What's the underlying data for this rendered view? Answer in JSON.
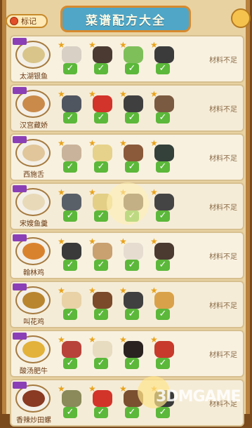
{
  "header": {
    "tag_label": "标记",
    "title": "菜谱配方大全"
  },
  "recipes": [
    {
      "name": "太湖银鱼",
      "status": "材料不足",
      "food_color": "#d9c58a",
      "ingredients": [
        {
          "icon": "garlic-icon",
          "color": "#d8d0c4",
          "checked": true
        },
        {
          "icon": "mushroom-icon",
          "color": "#4a3a32",
          "checked": true
        },
        {
          "icon": "leek-icon",
          "color": "#7fbf5a",
          "checked": true
        },
        {
          "icon": "sauce-icon",
          "color": "#3b3b3b",
          "checked": true
        }
      ]
    },
    {
      "name": "汉宫藏娇",
      "status": "材料不足",
      "food_color": "#c98a4a",
      "ingredients": [
        {
          "icon": "eel-icon",
          "color": "#505660",
          "checked": true
        },
        {
          "icon": "pepper-icon",
          "color": "#d2332a",
          "checked": true
        },
        {
          "icon": "sauce-icon",
          "color": "#3f3f3f",
          "checked": true
        },
        {
          "icon": "shiitake-icon",
          "color": "#7a5a40",
          "checked": true
        }
      ]
    },
    {
      "name": "西施舌",
      "status": "材料不足",
      "food_color": "#e0c69a",
      "ingredients": [
        {
          "icon": "clam-icon",
          "color": "#c9b39a",
          "checked": true
        },
        {
          "icon": "bamboo-shoot-icon",
          "color": "#e6d28a",
          "checked": true
        },
        {
          "icon": "shiitake-icon",
          "color": "#8a5a3a",
          "checked": true
        },
        {
          "icon": "bottle-icon",
          "color": "#34403a",
          "checked": true
        }
      ]
    },
    {
      "name": "宋嫂鱼羹",
      "status": "材料不足",
      "food_color": "#e8d9b8",
      "ingredients": [
        {
          "icon": "fish-icon",
          "color": "#5a6068",
          "checked": true
        },
        {
          "icon": "bamboo-shoot-icon",
          "color": "#e3cf86",
          "checked": true
        },
        {
          "icon": "mushroom-icon",
          "color": "#6a5040",
          "checked": true
        },
        {
          "icon": "sauce-icon",
          "color": "#444444",
          "checked": true
        }
      ]
    },
    {
      "name": "翰林鸡",
      "status": "材料不足",
      "food_color": "#d9822e",
      "ingredients": [
        {
          "icon": "sauce-icon",
          "color": "#3a3a3a",
          "checked": true
        },
        {
          "icon": "tofu-icon",
          "color": "#c9a070",
          "checked": true
        },
        {
          "icon": "garlic-icon",
          "color": "#e6ddd0",
          "checked": true
        },
        {
          "icon": "wine-jar-icon",
          "color": "#4a3a30",
          "checked": true
        }
      ]
    },
    {
      "name": "叫花鸡",
      "status": "材料不足",
      "food_color": "#b9852f",
      "ingredients": [
        {
          "icon": "chicken-icon",
          "color": "#e8d2a6",
          "checked": true
        },
        {
          "icon": "shiitake-icon",
          "color": "#7a4a2a",
          "checked": true
        },
        {
          "icon": "sauce-icon",
          "color": "#404040",
          "checked": true
        },
        {
          "icon": "ginger-icon",
          "color": "#d9a24a",
          "checked": true
        }
      ]
    },
    {
      "name": "酸汤肥牛",
      "status": "材料不足",
      "food_color": "#e2b23a",
      "ingredients": [
        {
          "icon": "beef-icon",
          "color": "#b8433a",
          "checked": true
        },
        {
          "icon": "enoki-icon",
          "color": "#e8dcc0",
          "checked": true
        },
        {
          "icon": "soy-sauce-icon",
          "color": "#2a2220",
          "checked": true
        },
        {
          "icon": "pepper-icon",
          "color": "#c73a2c",
          "checked": true
        }
      ]
    },
    {
      "name": "香辣炒田螺",
      "status": "材料不足",
      "food_color": "#8a3a22",
      "ingredients": [
        {
          "icon": "snail-icon",
          "color": "#8a8a5a",
          "checked": true
        },
        {
          "icon": "pepper-icon",
          "color": "#d3342a",
          "checked": true
        },
        {
          "icon": "shiitake-icon",
          "color": "#7a5030",
          "checked": true
        },
        {
          "icon": "sauce-icon",
          "color": "#3a3a3a",
          "checked": true
        }
      ]
    }
  ],
  "watermark": "3DMGAME"
}
